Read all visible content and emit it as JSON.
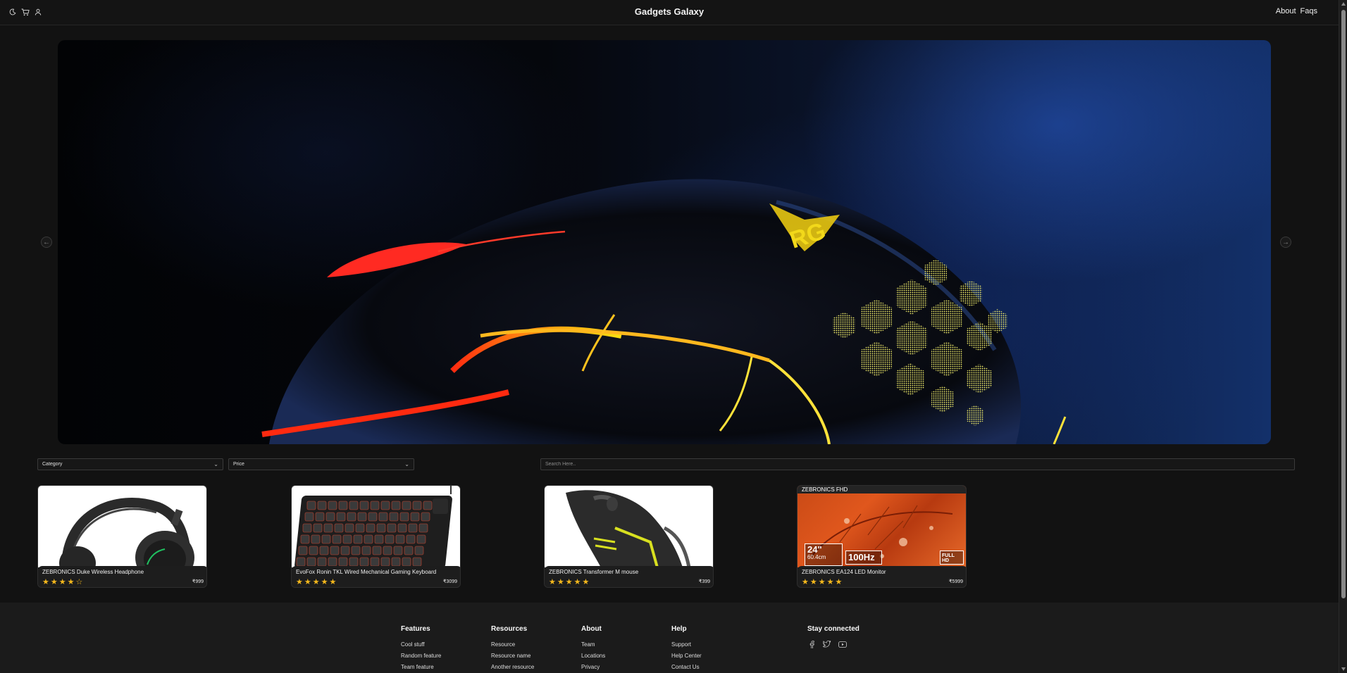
{
  "header": {
    "brand": "Gadgets Galaxy",
    "icons": [
      "moon-icon",
      "cart-icon",
      "user-icon"
    ],
    "links": [
      {
        "label": "About"
      },
      {
        "label": "Faqs"
      }
    ]
  },
  "hero": {
    "prev_icon": "arrow-left-icon",
    "next_icon": "arrow-right-icon",
    "logo_text": "RG"
  },
  "filters": {
    "category": {
      "selected": "Category"
    },
    "price": {
      "selected": "Price"
    },
    "search": {
      "placeholder": "Search Here..",
      "value": ""
    }
  },
  "products": [
    {
      "name": "ZEBRONICS Duke Wireless Headphone",
      "rating": 4,
      "max_rating": 5,
      "price": "₹999"
    },
    {
      "name": "EvoFox Ronin TKL Wired Mechanical Gaming Keyboard",
      "rating": 5,
      "max_rating": 5,
      "price": "₹3099"
    },
    {
      "name": "ZEBRONICS Transformer M mouse",
      "rating": 5,
      "max_rating": 5,
      "price": "₹399"
    },
    {
      "name": "ZEBRONICS EA124 LED Monitor",
      "rating": 5,
      "max_rating": 5,
      "price": "₹5999",
      "image_text": {
        "brand": "ZEBRONICS FHD",
        "size": "24\"",
        "size_cm": "60.4cm",
        "refresh": "100Hz",
        "badge": "FULL HD"
      }
    }
  ],
  "footer": {
    "columns": [
      {
        "title": "Features",
        "links": [
          "Cool stuff",
          "Random feature",
          "Team feature"
        ]
      },
      {
        "title": "Resources",
        "links": [
          "Resource",
          "Resource name",
          "Another resource"
        ]
      },
      {
        "title": "About",
        "links": [
          "Team",
          "Locations",
          "Privacy"
        ]
      },
      {
        "title": "Help",
        "links": [
          "Support",
          "Help Center",
          "Contact Us"
        ]
      }
    ],
    "social_title": "Stay connected",
    "social_icons": [
      "facebook-icon",
      "twitter-icon",
      "youtube-icon"
    ]
  },
  "colors": {
    "background": "#121212",
    "star": "#f4b81c",
    "footer": "#1b1b1b"
  }
}
